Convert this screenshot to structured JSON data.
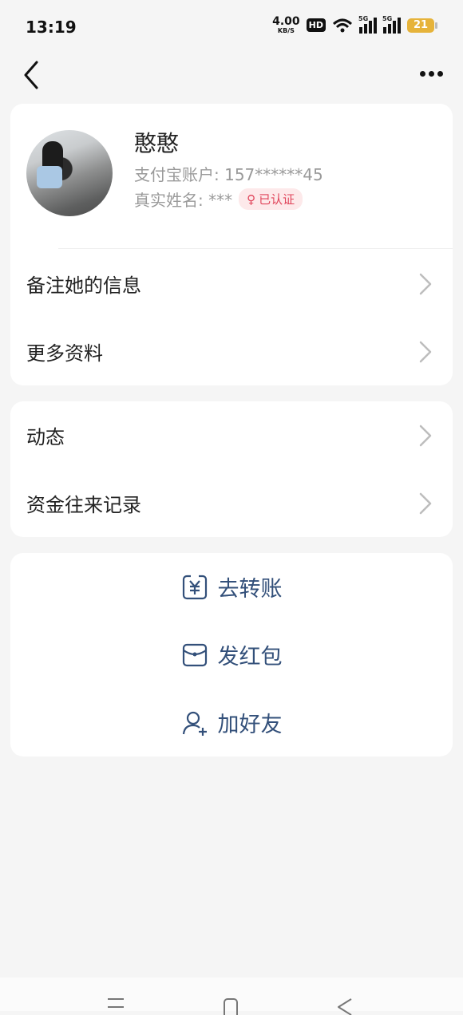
{
  "status": {
    "time": "13:19",
    "net_speed": "4.00",
    "net_unit": "KB/S",
    "hd": "HD",
    "signal1": "5G",
    "signal2": "5G",
    "battery": "21",
    "battery_color": "#e6b33a"
  },
  "profile": {
    "name": "憨憨",
    "account": "支付宝账户: 157******45",
    "realname": "真实姓名: ***",
    "badge_symbol": "♀",
    "badge": "已认证",
    "badge_color": "#e0445a"
  },
  "menu1": [
    {
      "label": "备注她的信息"
    },
    {
      "label": "更多资料"
    }
  ],
  "menu2": [
    {
      "label": "动态"
    },
    {
      "label": "资金往来记录"
    }
  ],
  "actions": [
    {
      "label": "去转账",
      "icon": "transfer-icon"
    },
    {
      "label": "发红包",
      "icon": "red-packet-icon"
    },
    {
      "label": "加好友",
      "icon": "add-friend-icon"
    }
  ],
  "accent_color": "#33507a"
}
